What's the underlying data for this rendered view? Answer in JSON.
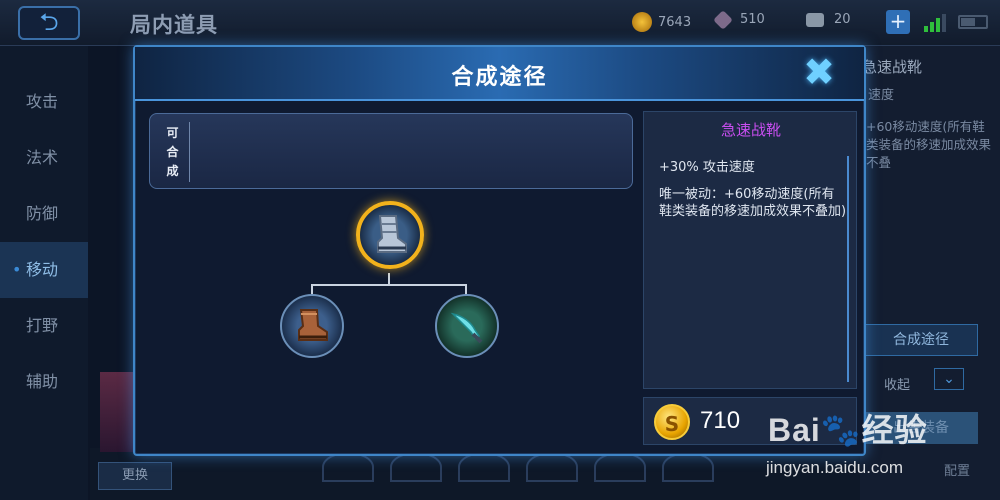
{
  "topbar": {
    "back_icon": "back-arrow-icon",
    "title": "局内道具",
    "gold": "7643",
    "gems": "510",
    "coupons": "20",
    "add_icon": "plus-icon",
    "signal_icon": "signal-icon",
    "battery_icon": "battery-icon"
  },
  "sidebar": {
    "items": [
      {
        "label": "攻击"
      },
      {
        "label": "法术"
      },
      {
        "label": "防御"
      },
      {
        "label": "移动",
        "active": true
      },
      {
        "label": "打野"
      },
      {
        "label": "辅助"
      }
    ]
  },
  "right_panel": {
    "title": "急速战靴",
    "sub": "速度",
    "desc": "+60移动速度(所有鞋类装备的移速加成效果不叠",
    "craft_button": "合成途径",
    "collapse_label": "收起",
    "sell_button": "出售装备",
    "config_label": "配置"
  },
  "bottom": {
    "swap_button": "更换"
  },
  "modal": {
    "title": "合成途径",
    "close_icon": "close-x-icon",
    "craftable_label": "可合成",
    "item_name": "急速战靴",
    "item_name_color": "#c84ef0",
    "stat": "+30% 攻击速度",
    "passive": "唯一被动：+60移动速度(所有鞋类装备的移速加成效果不叠加)",
    "price": "710",
    "coin_symbol": "S",
    "tree": {
      "main": {
        "icon": "swift-boots-icon"
      },
      "components": [
        {
          "icon": "leather-boots-icon"
        },
        {
          "icon": "dagger-icon"
        }
      ]
    }
  },
  "watermark": {
    "logo": "Bai du 经验",
    "url": "jingyan.baidu.com"
  }
}
